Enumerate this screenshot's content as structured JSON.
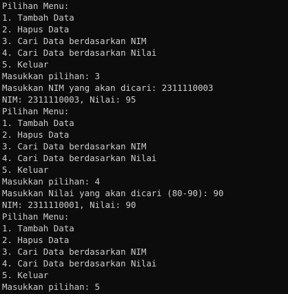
{
  "terminal": {
    "text_color": "#cccccc",
    "background_color": "#0c0c0c",
    "lines": [
      "Pilihan Menu:",
      "1. Tambah Data",
      "2. Hapus Data",
      "3. Cari Data berdasarkan NIM",
      "4. Cari Data berdasarkan Nilai",
      "5. Keluar",
      "Masukkan pilihan: 3",
      "Masukkan NIM yang akan dicari: 2311110003",
      "NIM: 2311110003, Nilai: 95",
      "Pilihan Menu:",
      "1. Tambah Data",
      "2. Hapus Data",
      "3. Cari Data berdasarkan NIM",
      "4. Cari Data berdasarkan Nilai",
      "5. Keluar",
      "Masukkan pilihan: 4",
      "Masukkan Nilai yang akan dicari (80-90): 90",
      "NIM: 2311110001, Nilai: 90",
      "Pilihan Menu:",
      "1. Tambah Data",
      "2. Hapus Data",
      "3. Cari Data berdasarkan NIM",
      "4. Cari Data berdasarkan Nilai",
      "5. Keluar",
      "Masukkan pilihan: 5"
    ]
  }
}
